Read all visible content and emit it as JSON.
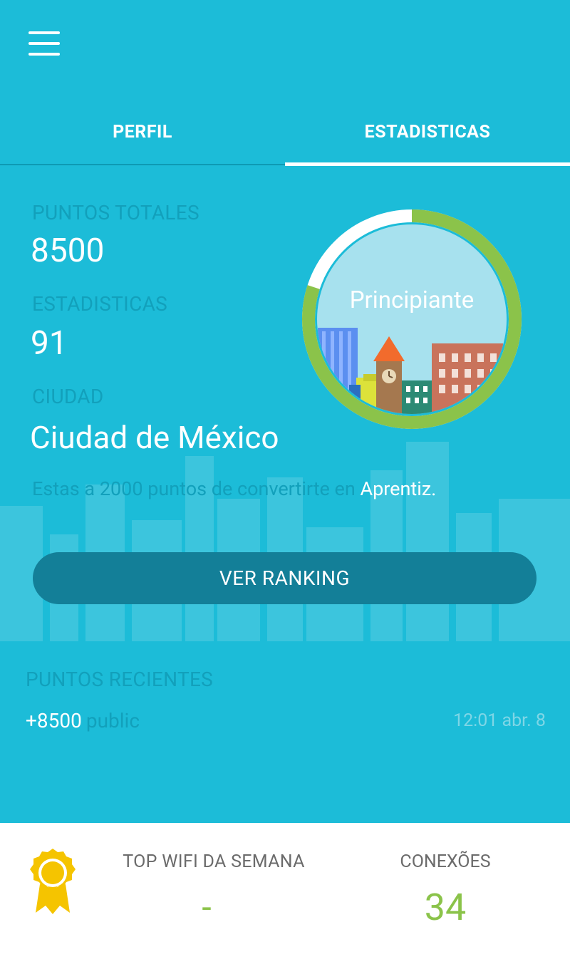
{
  "header": {
    "menu_icon": "hamburger-menu-icon"
  },
  "tabs": [
    {
      "label": "PERFIL",
      "active": false
    },
    {
      "label": "ESTADISTICAS",
      "active": true
    }
  ],
  "stats": {
    "points_label": "PUNTOS TOTALES",
    "points_value": "8500",
    "stats_label": "ESTADISTICAS",
    "stats_value": "91",
    "city_label": "CIUDAD",
    "city_value": "Ciudad de México"
  },
  "level": {
    "name": "Principiante",
    "progress": 0.8,
    "next_text_prefix": "Estas a 2000 puntos de convertirte en ",
    "next_level": "Aprentiz."
  },
  "ranking_button": "VER RANKING",
  "recent": {
    "title": "PUNTOS RECIENTES",
    "items": [
      {
        "amount": "+8500",
        "source": "public",
        "time": "12:01 abr. 8"
      }
    ]
  },
  "bottom": {
    "medal_icon": "medal-icon",
    "top_wifi_label": "TOP WIFI DA SEMANA",
    "top_wifi_value": "-",
    "connections_label": "CONEXÕES",
    "connections_value": "34"
  },
  "colors": {
    "background": "#1cbcd8",
    "accent_green": "#8bc34a",
    "button": "#137f98",
    "muted_label": "#12a0bb"
  }
}
